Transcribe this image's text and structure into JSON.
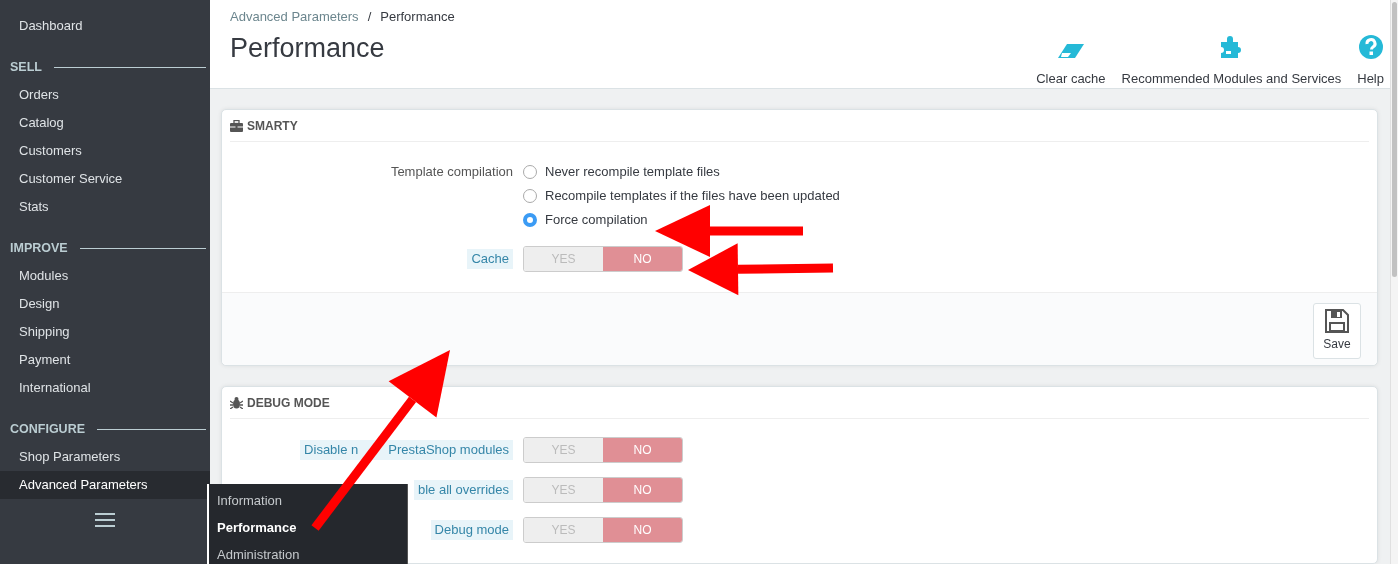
{
  "sidebar": {
    "groups": [
      {
        "items": [
          {
            "label": "Dashboard",
            "selected": false
          }
        ]
      },
      {
        "heading": "SELL",
        "items": [
          {
            "label": "Orders",
            "selected": false
          },
          {
            "label": "Catalog",
            "selected": false
          },
          {
            "label": "Customers",
            "selected": false
          },
          {
            "label": "Customer Service",
            "selected": false
          },
          {
            "label": "Stats",
            "selected": false
          }
        ]
      },
      {
        "heading": "IMPROVE",
        "items": [
          {
            "label": "Modules",
            "selected": false
          },
          {
            "label": "Design",
            "selected": false
          },
          {
            "label": "Shipping",
            "selected": false
          },
          {
            "label": "Payment",
            "selected": false
          },
          {
            "label": "International",
            "selected": false
          }
        ]
      },
      {
        "heading": "CONFIGURE",
        "items": [
          {
            "label": "Shop Parameters",
            "selected": false
          },
          {
            "label": "Advanced Parameters",
            "selected": true
          }
        ]
      }
    ],
    "submenu": [
      {
        "label": "Information",
        "selected": false
      },
      {
        "label": "Performance",
        "selected": true
      },
      {
        "label": "Administration",
        "selected": false
      }
    ]
  },
  "header": {
    "breadcrumb": [
      "Advanced Parameters",
      "Performance"
    ],
    "breadcrumb_separator": "/",
    "title": "Performance",
    "toolbar": [
      {
        "label": "Clear cache"
      },
      {
        "label": "Recommended Modules and Services"
      },
      {
        "label": "Help"
      }
    ]
  },
  "panels": [
    {
      "title": "SMARTY",
      "fields": [
        {
          "kind": "radio",
          "label": "Template compilation",
          "help": false,
          "options": [
            {
              "label": "Never recompile template files",
              "selected": false
            },
            {
              "label": "Recompile templates if the files have been updated",
              "selected": false
            },
            {
              "label": "Force compilation",
              "selected": true
            }
          ]
        },
        {
          "kind": "switch",
          "label": "Cache",
          "help": true,
          "on": false,
          "yes": "YES",
          "no": "NO"
        }
      ],
      "save": "Save"
    },
    {
      "title": "DEBUG MODE",
      "fields": [
        {
          "kind": "switch",
          "label_parts": [
            "Disable n",
            "PrestaShop modules"
          ],
          "help": true,
          "on": false,
          "yes": "YES",
          "no": "NO"
        },
        {
          "kind": "switch",
          "label": "ble all overrides",
          "help": true,
          "on": false,
          "yes": "YES",
          "no": "NO"
        },
        {
          "kind": "switch",
          "label": "Debug mode",
          "help": true,
          "on": false,
          "yes": "YES",
          "no": "NO"
        }
      ]
    }
  ]
}
